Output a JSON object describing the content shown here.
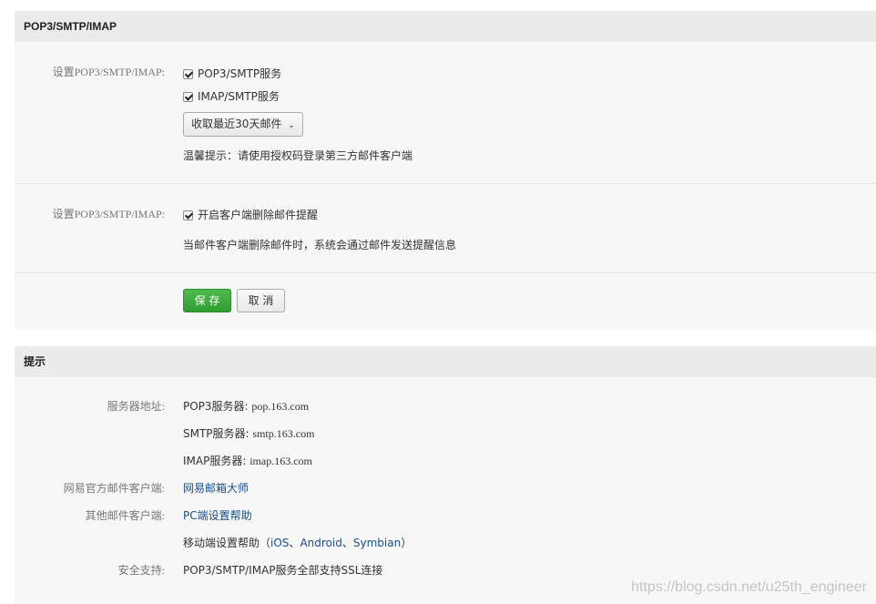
{
  "section1": {
    "header": "POP3/SMTP/IMAP",
    "row1_label": "设置POP3/SMTP/IMAP:",
    "opt_pop3": "POP3/SMTP服务",
    "opt_imap": "IMAP/SMTP服务",
    "dropdown_value": "收取最近30天邮件",
    "hint": "温馨提示：请使用授权码登录第三方邮件客户端",
    "row2_label": "设置POP3/SMTP/IMAP:",
    "opt_delete": "开启客户端删除邮件提醒",
    "delete_desc": "当邮件客户端删除邮件时，系统会通过邮件发送提醒信息",
    "save_label": "保 存",
    "cancel_label": "取 消"
  },
  "section2": {
    "header": "提示",
    "server_label": "服务器地址:",
    "pop3_prefix": "POP3服务器: ",
    "pop3_value": "pop.163.com",
    "smtp_prefix": "SMTP服务器: ",
    "smtp_value": "smtp.163.com",
    "imap_prefix": "IMAP服务器: ",
    "imap_value": "imap.163.com",
    "official_label": "网易官方邮件客户端:",
    "official_link": "网易邮箱大师",
    "other_label": "其他邮件客户端:",
    "pc_link": "PC端设置帮助",
    "mobile_prefix": "移动端设置帮助（",
    "ios": "iOS",
    "sep1": "、",
    "android": "Android",
    "sep2": "、",
    "symbian": "Symbian",
    "mobile_suffix": "）",
    "security_label": "安全支持:",
    "security_value": "POP3/SMTP/IMAP服务全部支持SSL连接"
  },
  "watermark": "https://blog.csdn.net/u25th_engineer",
  "colors": {
    "primary": "#3aa63a",
    "link": "#1a4f8b",
    "header_bg": "#ebebeb",
    "panel_bg": "#f7f7f7"
  }
}
